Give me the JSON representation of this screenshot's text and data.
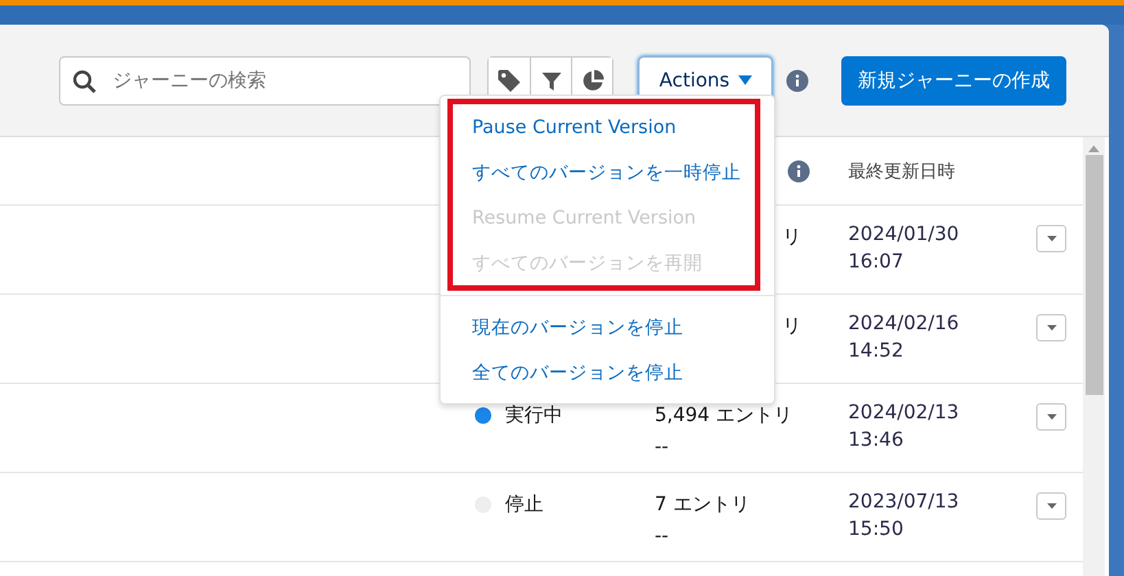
{
  "toolbar": {
    "search": {
      "placeholder": "ジャーニーの検索"
    },
    "actions_button": {
      "label": "Actions",
      "expanded": true
    },
    "new_button": "新規ジャーニーの作成"
  },
  "actions_menu": {
    "items": [
      {
        "label": "Pause Current Version",
        "disabled": false,
        "highlighted": true
      },
      {
        "label": "すべてのバージョンを一時停止",
        "disabled": false,
        "highlighted": true
      },
      {
        "label": "Resume Current Version",
        "disabled": true,
        "highlighted": true
      },
      {
        "label": "すべてのバージョンを再開",
        "disabled": true,
        "highlighted": true
      },
      {
        "label": "現在のバージョンを停止",
        "disabled": false,
        "highlighted": false
      },
      {
        "label": "全てのバージョンを停止",
        "disabled": false,
        "highlighted": false
      }
    ]
  },
  "table": {
    "columns": {
      "date": "最終更新日時"
    },
    "rows": [
      {
        "entries": "リ",
        "entries_partial": true,
        "date": "2024/01/30",
        "time": "16:07"
      },
      {
        "entries": "リ",
        "entries_partial": true,
        "date": "2024/02/16",
        "time": "14:52"
      },
      {
        "status": "実行中",
        "color": "#1b86e8",
        "entries": "5,494 エントリ",
        "entries_sub": "--",
        "entries_partial": false,
        "date": "2024/02/13",
        "time": "13:46"
      },
      {
        "status": "停止",
        "color": "#eeeeee",
        "entries": "7 エントリ",
        "entries_sub": "--",
        "entries_partial": false,
        "date": "2023/07/13",
        "time": "15:50"
      }
    ]
  }
}
